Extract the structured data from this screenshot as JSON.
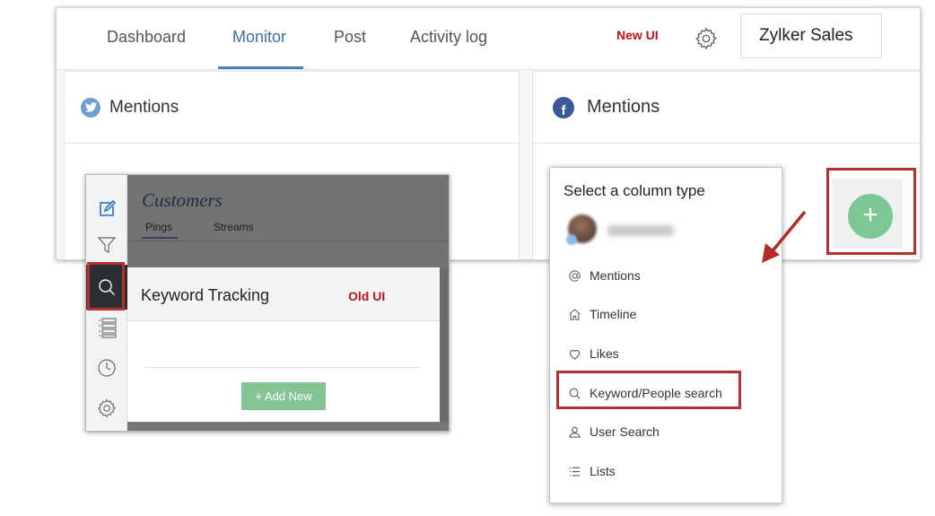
{
  "new_ui": {
    "nav_tabs": [
      {
        "label": "Dashboard"
      },
      {
        "label": "Monitor",
        "active": true
      },
      {
        "label": "Post"
      },
      {
        "label": "Activity log"
      }
    ],
    "annotation": "New UI",
    "brand": "Zylker Sales",
    "columns": [
      {
        "network": "twitter",
        "title": "Mentions"
      },
      {
        "network": "facebook",
        "title": "Mentions"
      }
    ],
    "add_column_label": "+",
    "facebook_letter": "f"
  },
  "old_ui": {
    "title": "Customers",
    "tabs": [
      {
        "label": "Pings",
        "active": true
      },
      {
        "label": "Streams"
      }
    ],
    "panel_title": "Keyword Tracking",
    "annotation": "Old UI",
    "add_new_label": "+ Add New",
    "sidebar_icons": [
      "compose-icon",
      "filter-icon",
      "search-icon",
      "list-icon",
      "clock-icon",
      "gear-icon"
    ]
  },
  "column_type_menu": {
    "title": "Select a column type",
    "items": [
      {
        "icon": "at-icon",
        "label": "Mentions"
      },
      {
        "icon": "home-icon",
        "label": "Timeline"
      },
      {
        "icon": "heart-icon",
        "label": "Likes"
      },
      {
        "icon": "search-icon",
        "label": "Keyword/People search",
        "highlighted": true
      },
      {
        "icon": "user-icon",
        "label": "User Search"
      },
      {
        "icon": "list-icon",
        "label": "Lists"
      }
    ]
  },
  "colors": {
    "accent": "#4a7fc1",
    "annotation_red": "#c0121b",
    "highlight_box": "#b8302e",
    "add_green": "#7dc794",
    "twitter": "#6e9fd2",
    "facebook": "#3b5998"
  }
}
